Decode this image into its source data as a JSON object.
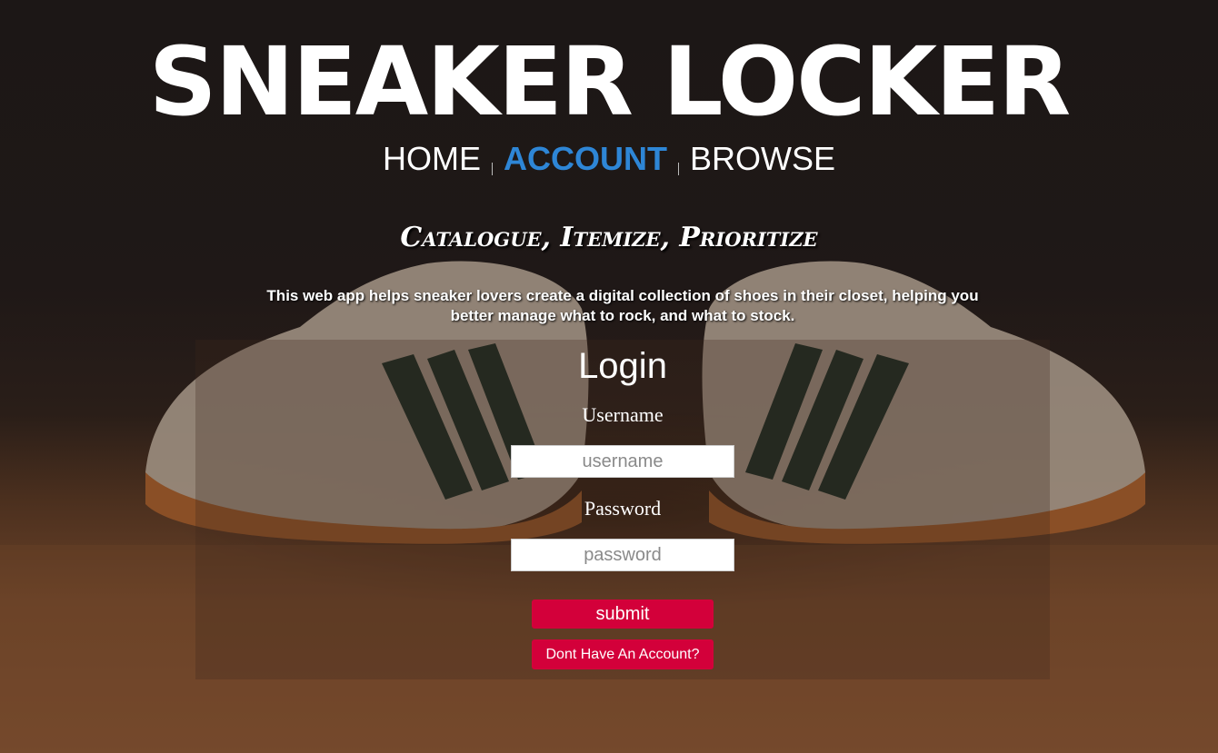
{
  "header": {
    "title": "SNEAKER LOCKER",
    "nav": [
      {
        "label": "HOME",
        "active": false
      },
      {
        "label": "ACCOUNT",
        "active": true
      },
      {
        "label": "BROWSE",
        "active": false
      }
    ]
  },
  "hero": {
    "tagline": "Catalogue, Itemize, Prioritize",
    "description": "This web app helps sneaker lovers create a digital collection of shoes in their closet, helping you better manage what to rock, and what to stock."
  },
  "login": {
    "title": "Login",
    "username_label": "Username",
    "username_placeholder": "username",
    "username_value": "",
    "password_label": "Password",
    "password_placeholder": "password",
    "password_value": "",
    "submit_label": "submit",
    "register_label": "Dont Have An Account?"
  },
  "colors": {
    "nav_active": "#2e86d6",
    "button": "#d3003a",
    "text": "#ffffff"
  }
}
